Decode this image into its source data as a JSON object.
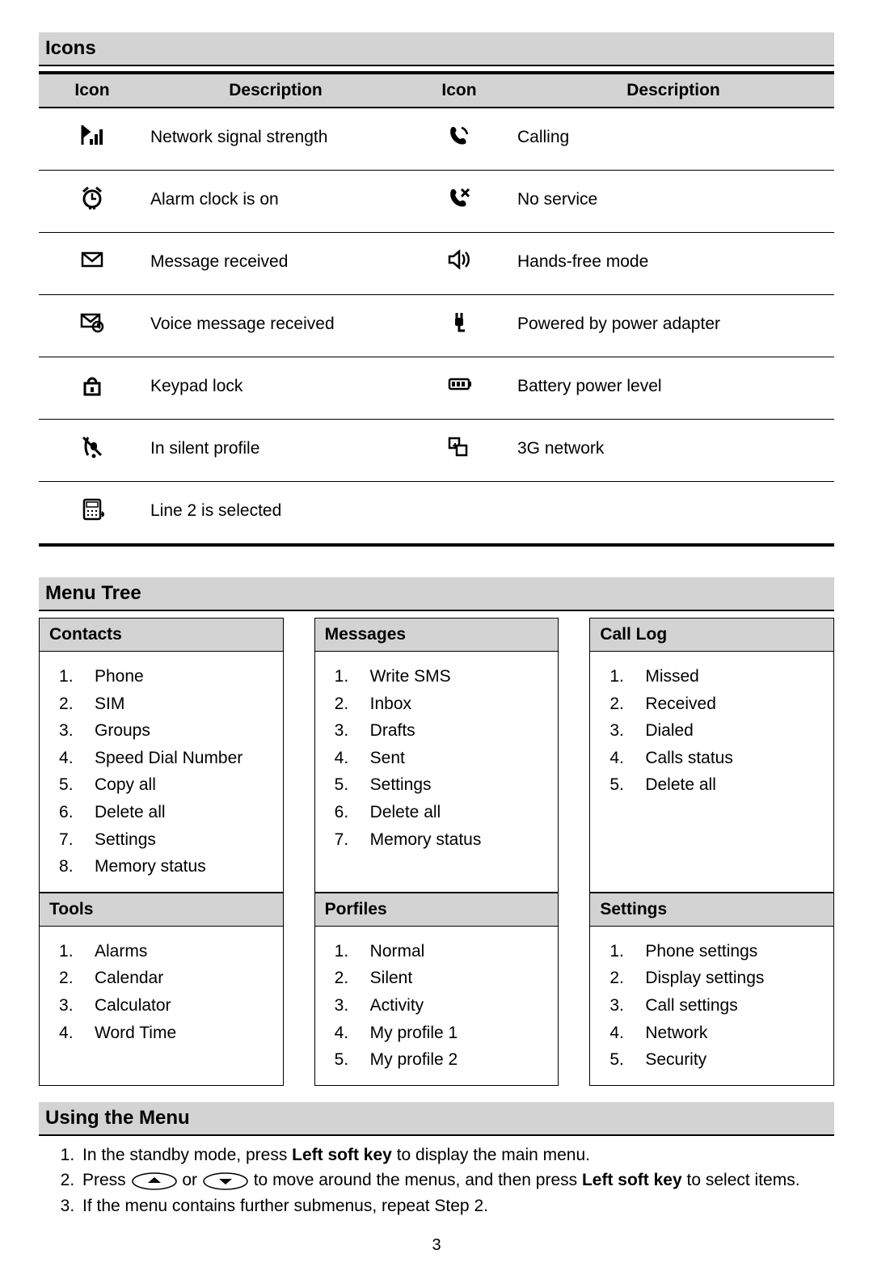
{
  "sections": {
    "icons_title": "Icons",
    "menu_tree_title": "Menu Tree",
    "using_title": "Using the Menu"
  },
  "icons_table": {
    "headers": {
      "icon": "Icon",
      "desc": "Description"
    },
    "rows": [
      {
        "left_icon": "signal",
        "left_desc": "Network signal strength",
        "right_icon": "calling",
        "right_desc": "Calling"
      },
      {
        "left_icon": "alarm",
        "left_desc": "Alarm clock is on",
        "right_icon": "noservice",
        "right_desc": "No service"
      },
      {
        "left_icon": "message",
        "left_desc": "Message received",
        "right_icon": "speaker",
        "right_desc": "Hands-free mode"
      },
      {
        "left_icon": "voicemail",
        "left_desc": "Voice message received",
        "right_icon": "plug",
        "right_desc": "Powered by power adapter"
      },
      {
        "left_icon": "lock",
        "left_desc": "Keypad lock",
        "right_icon": "battery",
        "right_desc": "Battery power level"
      },
      {
        "left_icon": "silent",
        "left_desc": "In silent profile",
        "right_icon": "3g",
        "right_desc": "3G network"
      },
      {
        "left_icon": "line2",
        "left_desc": "Line 2 is selected",
        "right_icon": "",
        "right_desc": ""
      }
    ]
  },
  "menu_tree": {
    "cards": [
      {
        "title": "Contacts",
        "items": [
          "Phone",
          "SIM",
          "Groups",
          "Speed Dial Number",
          "Copy all",
          "Delete all",
          "Settings",
          "Memory status"
        ],
        "style": "serif"
      },
      {
        "title": "Messages",
        "items": [
          "Write SMS",
          "Inbox",
          "Drafts",
          "Sent",
          "Settings",
          "Delete all",
          "Memory status"
        ],
        "style": "serif"
      },
      {
        "title": "Call Log",
        "items": [
          "Missed",
          "Received",
          "Dialed",
          "Calls status",
          "Delete all"
        ],
        "style": "sans"
      },
      {
        "title": "Tools",
        "items": [
          "Alarms",
          "Calendar",
          "Calculator",
          "Word Time"
        ],
        "style": "sans"
      },
      {
        "title": "Porfiles",
        "items": [
          "Normal",
          "Silent",
          "Activity",
          "My profile 1",
          "My profile 2"
        ],
        "style": "sans"
      },
      {
        "title": "Settings",
        "items": [
          "Phone settings",
          "Display settings",
          "Call settings",
          "Network",
          "Security"
        ],
        "style": "serif"
      }
    ]
  },
  "using": {
    "steps": [
      {
        "pre": "In the standby mode, press ",
        "bold": "Left soft key",
        "post": " to display the main menu."
      },
      {
        "pre": "Press ",
        "mid": " or ",
        "post_pre": " to move around the menus, and then press ",
        "bold": "Left soft key",
        "post": " to select items."
      },
      {
        "pre": "If the menu contains further submenus, repeat Step 2."
      }
    ]
  },
  "page_number": "3"
}
